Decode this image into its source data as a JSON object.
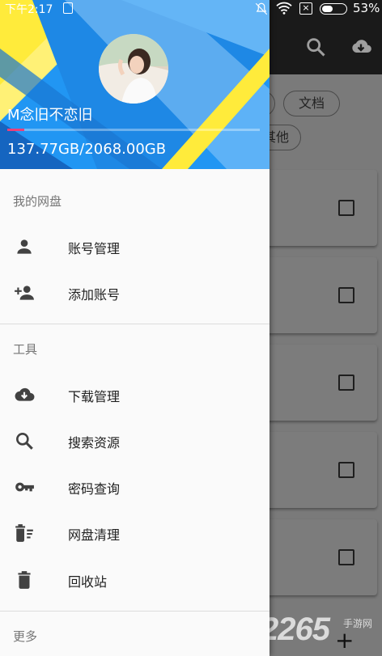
{
  "status_bar": {
    "time": "下午2:17",
    "battery": "53%",
    "battery_level": 0.53
  },
  "background": {
    "chips": [
      "文档",
      "其他"
    ],
    "card_count": 5
  },
  "drawer": {
    "username": "M念旧不恋旧",
    "quota_text": "137.77GB/2068.00GB",
    "quota_used_fraction": 0.0666,
    "sections": [
      {
        "title": "我的网盘",
        "items": [
          {
            "label": "账号管理",
            "icon": "person-icon"
          },
          {
            "label": "添加账号",
            "icon": "person-add-icon"
          }
        ]
      },
      {
        "title": "工具",
        "items": [
          {
            "label": "下载管理",
            "icon": "cloud-download-icon"
          },
          {
            "label": "搜索资源",
            "icon": "search-icon"
          },
          {
            "label": "密码查询",
            "icon": "key-icon"
          },
          {
            "label": "网盘清理",
            "icon": "delete-sweep-icon"
          },
          {
            "label": "回收站",
            "icon": "trash-icon"
          }
        ]
      },
      {
        "title": "更多",
        "items": []
      }
    ]
  },
  "watermark": {
    "number": "2265",
    "site": "手游网"
  },
  "colors": {
    "header_blue": "#2196f3",
    "accent_yellow": "#ffeb3b",
    "progress_pink": "#ec407a",
    "icon_gray": "#424242"
  }
}
